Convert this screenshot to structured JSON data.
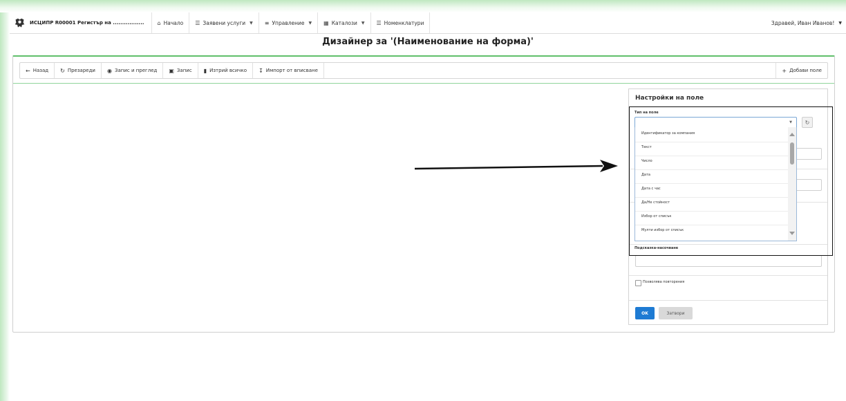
{
  "navbar": {
    "brand": "ИСЦИПР R00001 Регистър на .................",
    "items": [
      {
        "label": "Начало",
        "icon": "home-icon",
        "caret": false
      },
      {
        "label": "Заявени услуги",
        "icon": "database-icon",
        "caret": true
      },
      {
        "label": "Управление",
        "icon": "sliders-icon",
        "caret": true
      },
      {
        "label": "Каталози",
        "icon": "table-icon",
        "caret": true
      },
      {
        "label": "Номенклатури",
        "icon": "list-icon",
        "caret": false
      }
    ],
    "user": "Здравей, Иван Иванов!"
  },
  "page_title": "Дизайнер за '(Наименование на форма)'",
  "toolbar": {
    "back": "Назад",
    "reload": "Презареди",
    "save_preview": "Запис и преглед",
    "save": "Запис",
    "delete_all": "Изтрий всичко",
    "import": "Импорт от вписване",
    "add_field": "Добави поле"
  },
  "settings": {
    "title": "Настройки на поле",
    "field_type_label": "Тип на поле",
    "field_type_value": "",
    "options": [
      "Идентификатор за компания",
      "Текст",
      "Число",
      "Дата",
      "Дата с час",
      "Да/Не стойност",
      "Избор от списък",
      "Мулти избор от списък"
    ],
    "hint_label": "Подсказка-насочване",
    "allow_repeat_label": "Позволява повторения",
    "ok": "OK",
    "close": "Затвори"
  },
  "colors": {
    "accent_green": "#5fbf6a",
    "primary_blue": "#1e7bd3"
  }
}
